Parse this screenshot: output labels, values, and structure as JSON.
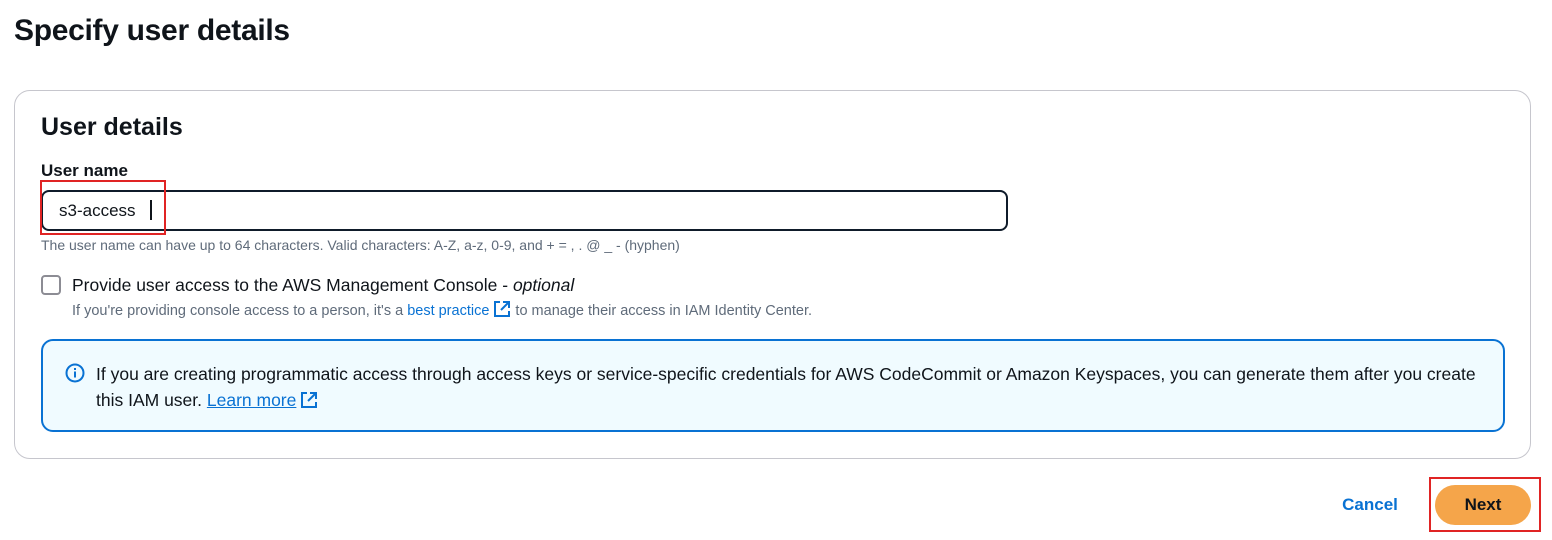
{
  "page": {
    "title": "Specify user details"
  },
  "card": {
    "title": "User details",
    "username_label": "User name",
    "username_value": "s3-access",
    "username_constraint": "The user name can have up to 64 characters. Valid characters: A-Z, a-z, 0-9, and + = , . @ _ - (hyphen)",
    "console_access": {
      "label_main": "Provide user access to the AWS Management Console - ",
      "label_optional": "optional",
      "checked": false,
      "desc_before": "If you're providing console access to a person, it's a ",
      "desc_link": "best practice",
      "desc_after": " to manage their access in IAM Identity Center."
    },
    "alert": {
      "text": "If you are creating programmatic access through access keys or service-specific credentials for AWS CodeCommit or Amazon Keyspaces, you can generate them after you create this IAM user. ",
      "link": "Learn more"
    }
  },
  "actions": {
    "cancel_label": "Cancel",
    "next_label": "Next"
  },
  "colors": {
    "link": "#0972d3",
    "primary_button": "#f5a54a",
    "alert_border": "#0972d3",
    "alert_background": "#f0fbff",
    "highlight": "#e02424"
  },
  "icons": {
    "external_link": "external-link-icon",
    "info": "info-icon"
  }
}
